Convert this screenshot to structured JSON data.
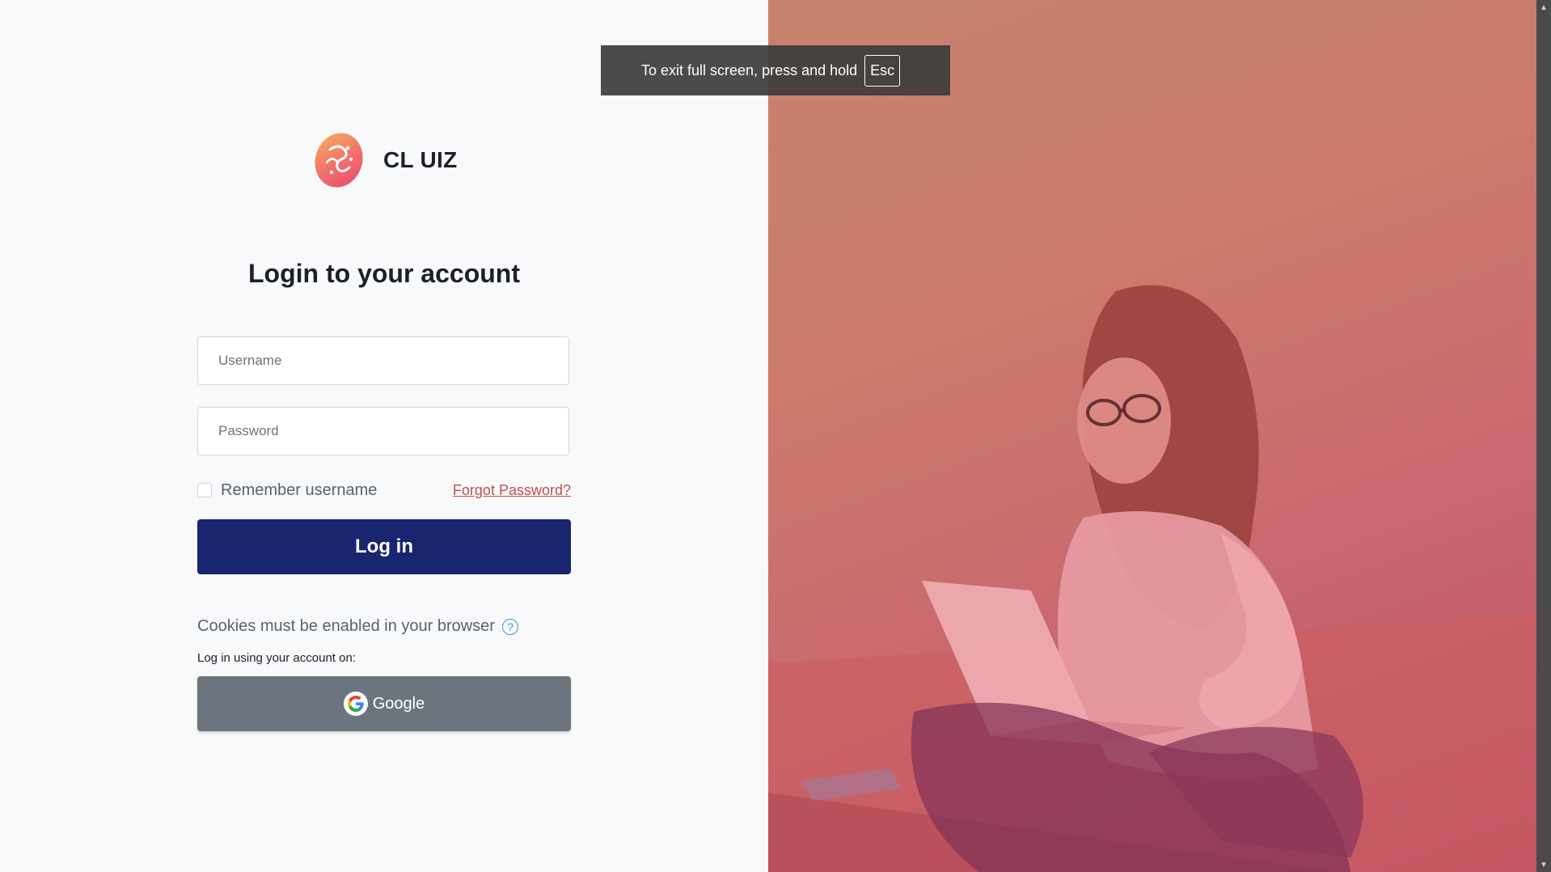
{
  "brand": {
    "name": "CL UIZ",
    "logo_icon": "cl-uiz-logo-icon"
  },
  "login": {
    "title": "Login to your account",
    "username_placeholder": "Username",
    "username_value": "",
    "password_placeholder": "Password",
    "password_value": "",
    "remember_label": "Remember username",
    "remember_checked": false,
    "forgot_label": "Forgot Password?",
    "submit_label": "Log in"
  },
  "cookies": {
    "text": "Cookies must be enabled in your browser",
    "help_icon": "question-circle-icon",
    "help_glyph": "?"
  },
  "identity_providers": {
    "label": "Log in using your account on:",
    "google_label": "Google",
    "google_icon": "google-icon"
  },
  "fullscreen_toast": {
    "text": "To exit full screen, press and hold",
    "key": "Esc"
  },
  "scrollbar": {
    "up_glyph": "▲",
    "down_glyph": "▼"
  },
  "colors": {
    "login_button": "#1a2570",
    "google_button": "#6c757d",
    "forgot_link": "#c0504d",
    "help_icon": "#3d97c9",
    "hero_overlay": "#c4626c"
  }
}
